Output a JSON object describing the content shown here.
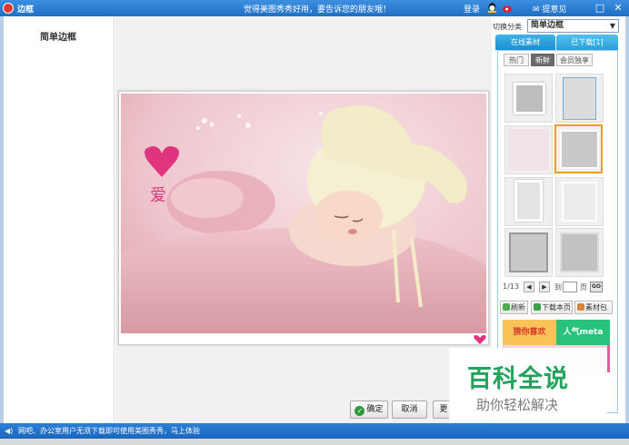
{
  "window": {
    "title": "边框",
    "promo": "觉得美图秀秀好用，要告诉您的朋友哦！",
    "login": "登录",
    "feedback": "提意见",
    "min_icon": "minimize-icon",
    "close_icon": "close-icon"
  },
  "left_panel": {
    "frame_name": "简单边框"
  },
  "right_panel": {
    "category_label": "切换分类",
    "category_value": "简单边框",
    "tabs": [
      {
        "label": "在线素材"
      },
      {
        "label": "已下载[1]"
      }
    ],
    "sub_tabs": [
      {
        "label": "热门"
      },
      {
        "label": "新鲜"
      },
      {
        "label": "会员独享"
      }
    ],
    "pager": {
      "page": "1/13",
      "goto": "到",
      "unit": "页",
      "go": "GO",
      "prev": "◀",
      "next": "▶"
    },
    "actions": [
      {
        "label": "刷新"
      },
      {
        "label": "下载本页"
      },
      {
        "label": "素材包"
      }
    ],
    "banner": {
      "left": "猜你喜欢",
      "right": "人气meta"
    }
  },
  "dialog_buttons": {
    "ok": "确定",
    "cancel": "取消",
    "partial": "更"
  },
  "watermark": {
    "title": "百科全说",
    "subtitle": "助你轻松解决"
  },
  "statusbar": {
    "text": "网吧、办公室用户无须下载即可使用美图秀秀，马上体验"
  },
  "photo": {
    "heart_label": "爱"
  },
  "colors": {
    "titlebar": "#1f6fc6",
    "accent": "#23a35b",
    "tab": "#1b8ed0"
  }
}
